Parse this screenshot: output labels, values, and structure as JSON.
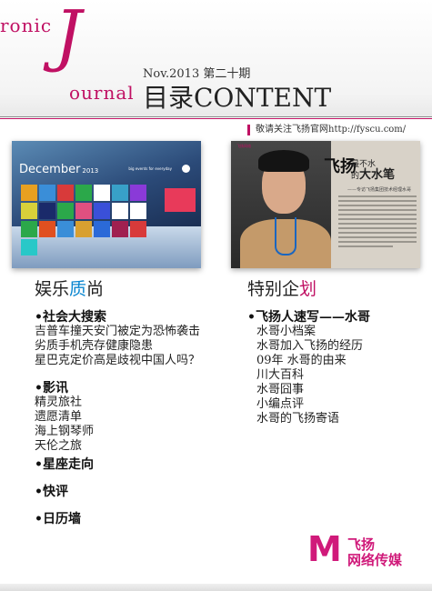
{
  "colors": {
    "brand": "#c01063",
    "accent_blue": "#0a86d0"
  },
  "masthead": {
    "logo_top": "ronic",
    "logo_initial": "J",
    "logo_bottom": "ournal",
    "issue": "Nov.2013  第二十期",
    "toc_title": "目录CONTENT",
    "follow": "敬请关注飞扬官网http://fyscu.com/"
  },
  "left_card": {
    "title": "December",
    "year": "2013",
    "greeting": "big events for everyday",
    "tiles": [
      "#e8a020",
      "#3a8ed8",
      "#d83a3a",
      "#2ba84a",
      "#ffffff",
      "#38a0c8",
      "#8a3ad8",
      "#d8d03a",
      "#1a2a6a",
      "#2ba84a",
      "#e05080",
      "#3a50d8",
      "#ffffff",
      "#ffffff",
      "#2ba84a",
      "#e05020",
      "#3a8ed8",
      "#d8a030",
      "#2b6ad8",
      "#a02050",
      "#d83a3a",
      "#28c8c8"
    ],
    "wide_tile_color": "#e83a5a"
  },
  "right_card": {
    "mag_logo": "飞扬网络",
    "headline_word": "飞扬",
    "headline_line1": "最不水",
    "headline_line2": "的",
    "headline_big": "大水笔",
    "subheading": "——专访飞扬集团技术经理水哥"
  },
  "sections": {
    "left": {
      "title_pre": "娱乐",
      "title_hl": "质",
      "title_post": "尚",
      "groups": [
        {
          "head": "•社会大搜索",
          "items": [
            "吉普车撞天安门被定为恐怖袭击",
            "劣质手机壳存健康隐患",
            "星巴克定价高是歧视中国人吗？"
          ]
        },
        {
          "head": "•影讯",
          "items": [
            "精灵旅社",
            "遗愿清单",
            "海上钢琴师",
            "天伦之旅"
          ]
        },
        {
          "head": "•星座走向",
          "items": []
        },
        {
          "head": "•快评",
          "items": []
        },
        {
          "head": "•日历墙",
          "items": []
        }
      ]
    },
    "right": {
      "title_pre": "特别企",
      "title_hl": "划",
      "groups": [
        {
          "head": "•飞扬人速写——水哥",
          "items": [
            "水哥小档案",
            "水哥加入飞扬的经历",
            "09年 水哥的由来",
            "川大百科",
            "水哥囧事",
            "小编点评",
            "水哥的飞扬寄语"
          ]
        }
      ]
    }
  },
  "footer_logo": {
    "mark": "M",
    "line1": "飞扬",
    "line2": "网络传媒"
  }
}
